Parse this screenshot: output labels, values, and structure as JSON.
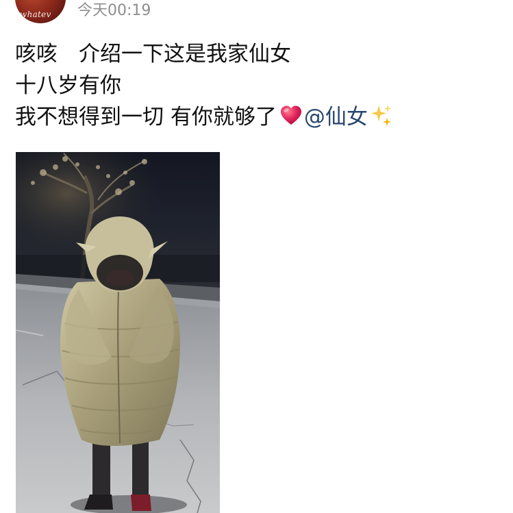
{
  "post": {
    "avatar": {
      "label": "whatev"
    },
    "timestamp": "今天00:19",
    "text": {
      "line1": "咳咳　介绍一下这是我家仙女",
      "line2": "十八岁有你",
      "line3_prefix": "我不想得到一切 有你就够了",
      "mention": "@仙女",
      "emojis": [
        "heart-icon",
        "sparkles-icon"
      ]
    },
    "photo": {
      "icon": "photo-person-in-hooded-coat"
    }
  },
  "colors": {
    "mention": "#27466e",
    "timestamp": "#8e8e8e",
    "heart": "#e0245e",
    "sparkles": "#f7c948"
  }
}
